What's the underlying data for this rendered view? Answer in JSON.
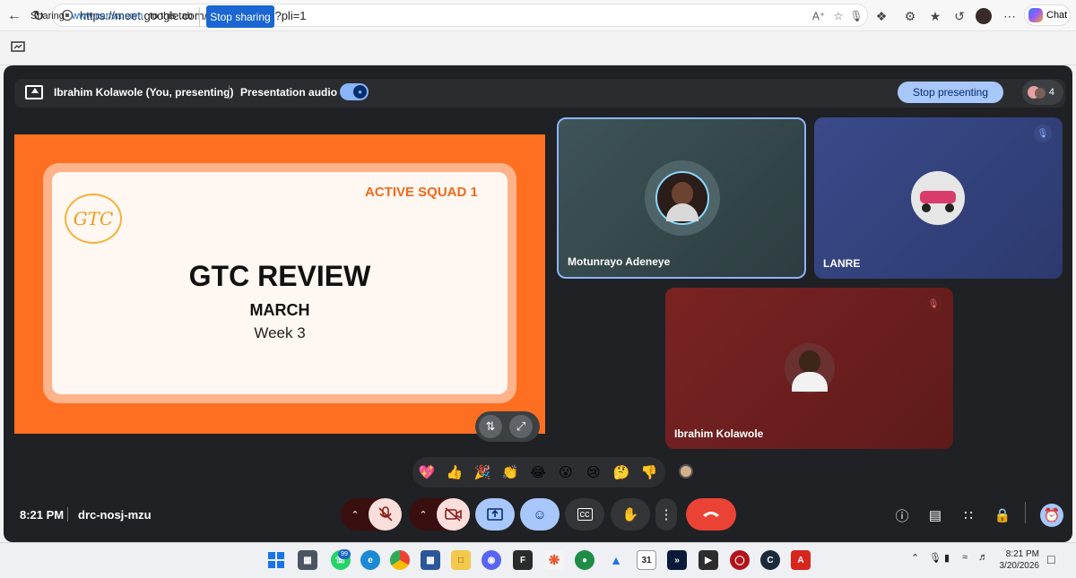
{
  "browser": {
    "url": "https://meet.google.com/drc-nosj-mzu?pli=1",
    "chat_label": "Chat"
  },
  "share_bar": {
    "sharing_label": "Sharing",
    "site": "www.canva.com",
    "to_tab": "to this tab",
    "stop_sharing": "Stop sharing"
  },
  "presenting_bar": {
    "presenter": "Ibrahim Kolawole (You, presenting)",
    "audio_label": "Presentation audio",
    "stop_presenting": "Stop presenting",
    "people_count": "4"
  },
  "slide": {
    "logo_text": "GTC",
    "squad": "ACTIVE SQUAD 1",
    "title": "GTC REVIEW",
    "month": "MARCH",
    "week": "Week 3"
  },
  "participants": [
    {
      "name": "Motunrayo Adeneye",
      "muted": false
    },
    {
      "name": "LANRE",
      "muted": true
    },
    {
      "name": "Ibrahim Kolawole",
      "muted": true
    }
  ],
  "reactions": [
    "💖",
    "👍",
    "🎉",
    "👏",
    "😂",
    "😮",
    "😢",
    "🤔",
    "👎"
  ],
  "meeting": {
    "time": "8:21 PM",
    "code": "drc-nosj-mzu"
  },
  "taskbar": {
    "whatsapp_badge": "99",
    "calendar_day": "31",
    "tray_time": "8:21 PM",
    "tray_date": "3/20/2026"
  },
  "colors": {
    "meet_bg": "#202124",
    "slide_orange": "#ff6f21",
    "end_call": "#ea4335",
    "accent_blue": "#a8c7fa"
  }
}
